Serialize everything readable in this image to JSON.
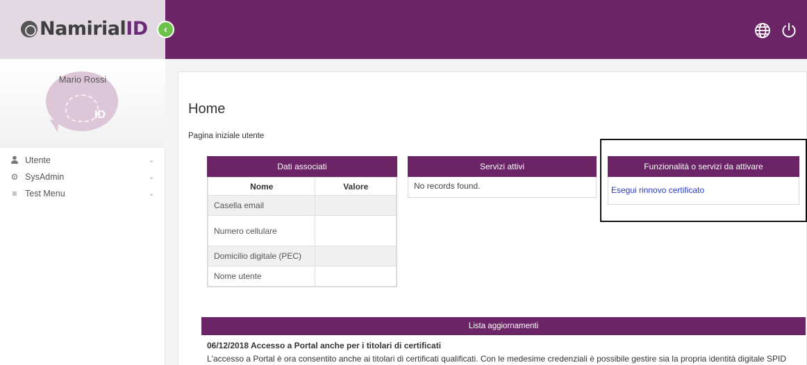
{
  "brand": {
    "logo_main": "Namirial",
    "logo_id": "ID"
  },
  "sidebar": {
    "user_name": "Mario Rossi",
    "avatar_mark": "ID",
    "items": [
      {
        "label": "Utente",
        "icon": "user-icon"
      },
      {
        "label": "SysAdmin",
        "icon": "gears-icon"
      },
      {
        "label": "Test Menu",
        "icon": "hamburger-icon"
      }
    ]
  },
  "topbar": {
    "icons": [
      "globe-icon",
      "power-icon"
    ]
  },
  "main": {
    "title": "Home",
    "subtitle": "Pagina iniziale utente",
    "dati": {
      "header": "Dati associati",
      "columns": [
        "Nome",
        "Valore"
      ],
      "rows": [
        {
          "name": "Casella email",
          "value": ""
        },
        {
          "name": "Numero cellulare",
          "value": ""
        },
        {
          "name": "Domicilio digitale (PEC)",
          "value": ""
        },
        {
          "name": "Nome utente",
          "value": ""
        }
      ]
    },
    "servizi": {
      "header": "Servizi attivi",
      "empty": "No records found."
    },
    "funzionalita": {
      "header": "Funzionalità o servizi da attivare",
      "link": "Esegui rinnovo certificato"
    },
    "lista": {
      "header": "Lista aggiornamenti",
      "news_title": "06/12/2018 Accesso a Portal anche per i titolari di certificati",
      "news_text": "L'accesso a Portal è ora consentito anche ai titolari di certificati qualificati. Con le medesime credenziali è possibile gestire sia la propria identità digitale SPID che i propri certificati."
    }
  },
  "colors": {
    "primary": "#6b2466",
    "accent": "#6dc24b",
    "brand_bg": "#e3d9e3",
    "link": "#2a3cc7"
  }
}
